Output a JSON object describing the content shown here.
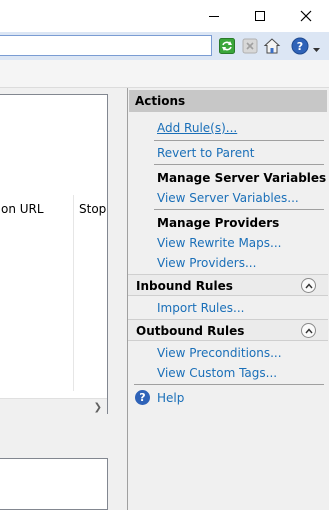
{
  "window": {
    "caption_buttons": [
      "minimize-icon",
      "maximize-icon",
      "close-icon"
    ]
  },
  "toolbar": {
    "icons": [
      "go-icon",
      "stop-icon",
      "home-icon",
      "help-icon",
      "chevron-down-icon"
    ]
  },
  "list": {
    "columns": [
      "on URL",
      "Stop"
    ]
  },
  "actions": {
    "header": "Actions",
    "add_rule": "Add Rule(s)...",
    "revert_to_parent": "Revert to Parent",
    "manage_server_variables_title": "Manage Server Variables",
    "view_server_variables": "View Server Variables...",
    "manage_providers_title": "Manage Providers",
    "view_rewrite_maps": "View Rewrite Maps...",
    "view_providers": "View Providers...",
    "inbound_rules_title": "Inbound Rules",
    "import_rules": "Import Rules...",
    "outbound_rules_title": "Outbound Rules",
    "view_preconditions": "View Preconditions...",
    "view_custom_tags": "View Custom Tags...",
    "help": "Help"
  },
  "colors": {
    "link": "#1a6fb8",
    "actions_header_bg": "#c7c7c7",
    "address_bar_bg": "#dce6f4"
  }
}
